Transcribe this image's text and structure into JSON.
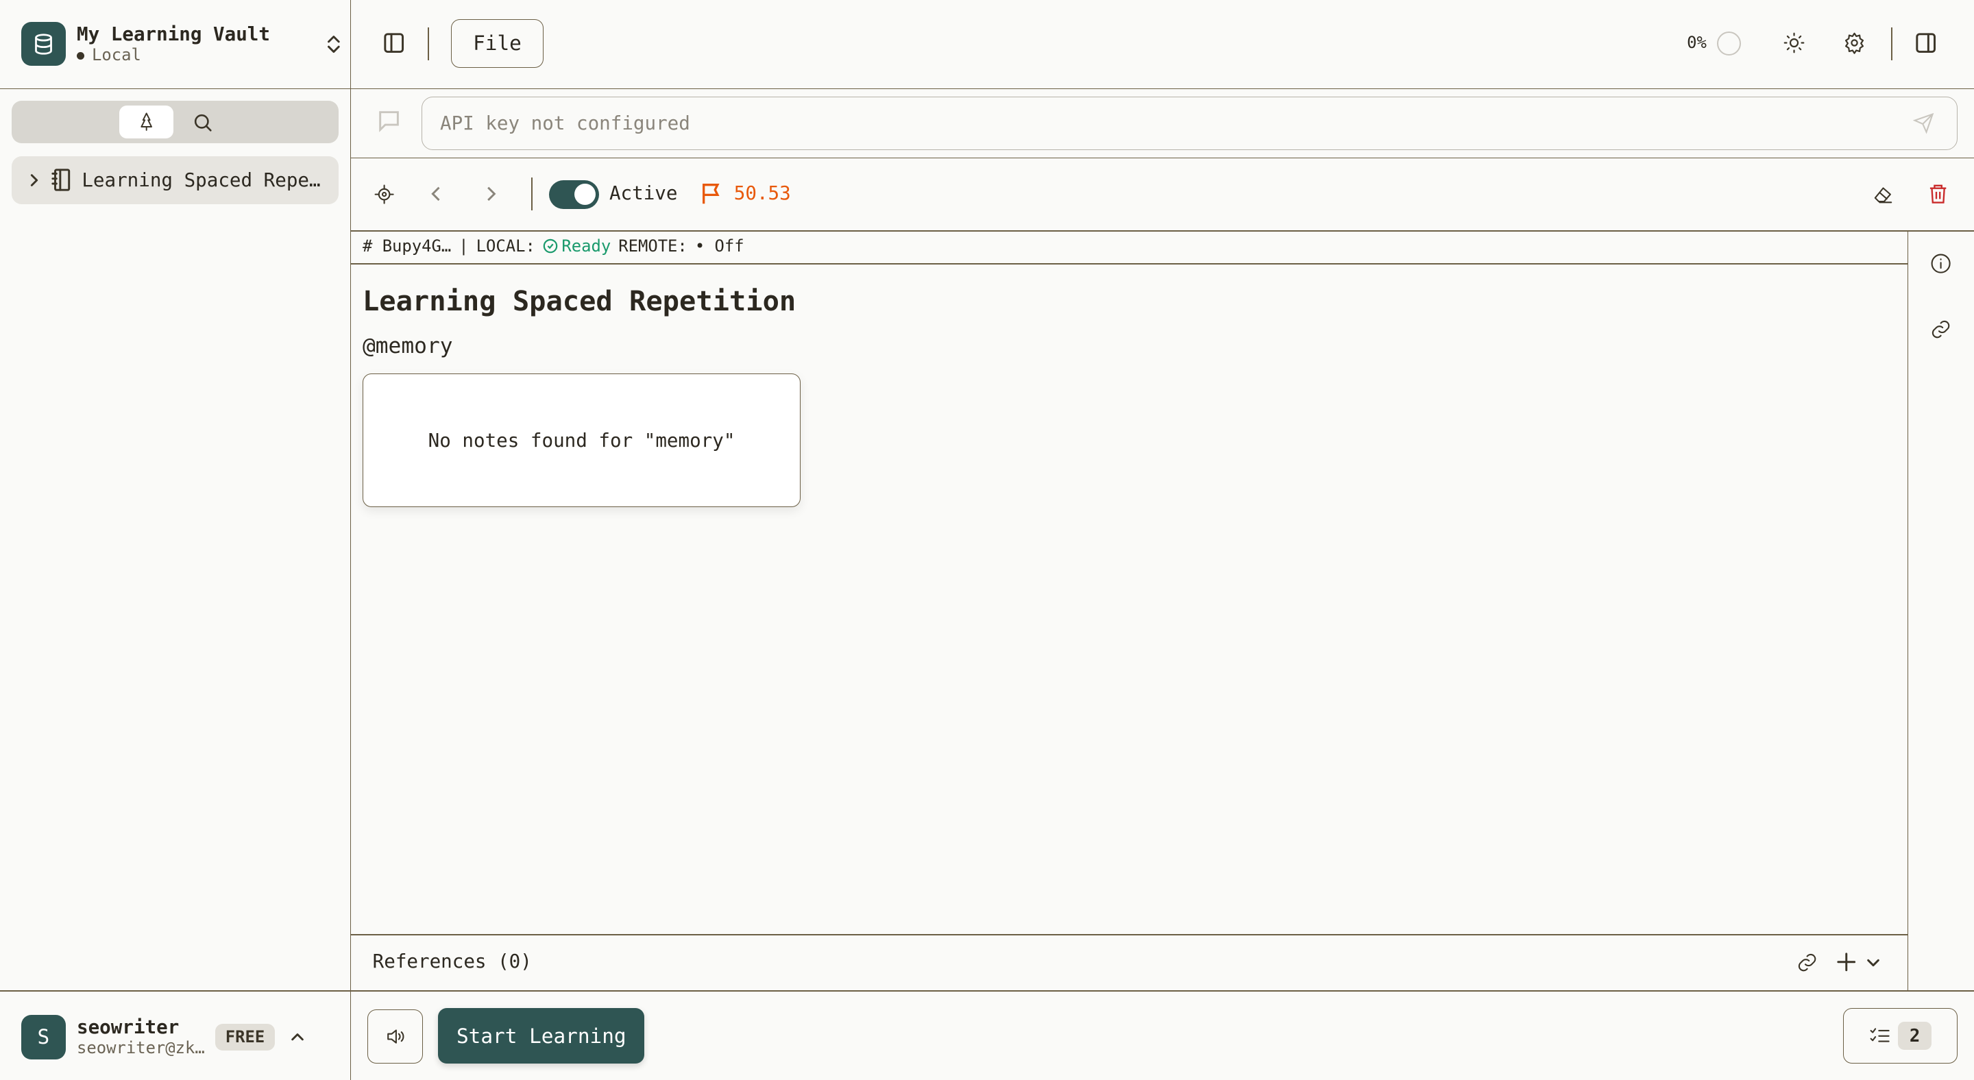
{
  "vault": {
    "name": "My Learning Vault",
    "status": "Local"
  },
  "sidebar": {
    "tree_item": "Learning Spaced Repe…"
  },
  "user": {
    "initial": "S",
    "name": "seowriter",
    "email": "seowriter@zk…",
    "plan": "FREE"
  },
  "toolbar": {
    "file_label": "File",
    "progress": "0%"
  },
  "chat": {
    "placeholder": "API key not configured"
  },
  "note_toolbar": {
    "active_label": "Active",
    "active": true,
    "score": "50.53"
  },
  "status_bar": {
    "id": "# Bupy4G…",
    "sep": "|",
    "local_label": "LOCAL:",
    "local_status": "Ready",
    "remote_label": "REMOTE:",
    "remote_status": "• Off"
  },
  "note": {
    "title": "Learning Spaced Repetition",
    "tag": "@memory",
    "popup": "No notes found for \"memory\""
  },
  "references": {
    "label": "References (0)"
  },
  "bottom": {
    "start_label": "Start Learning",
    "task_count": "2"
  },
  "colors": {
    "accent": "#2f5553",
    "border": "#6b5f45",
    "score": "#e8590c",
    "ready": "#1a9a6c",
    "danger": "#c92a2a"
  }
}
